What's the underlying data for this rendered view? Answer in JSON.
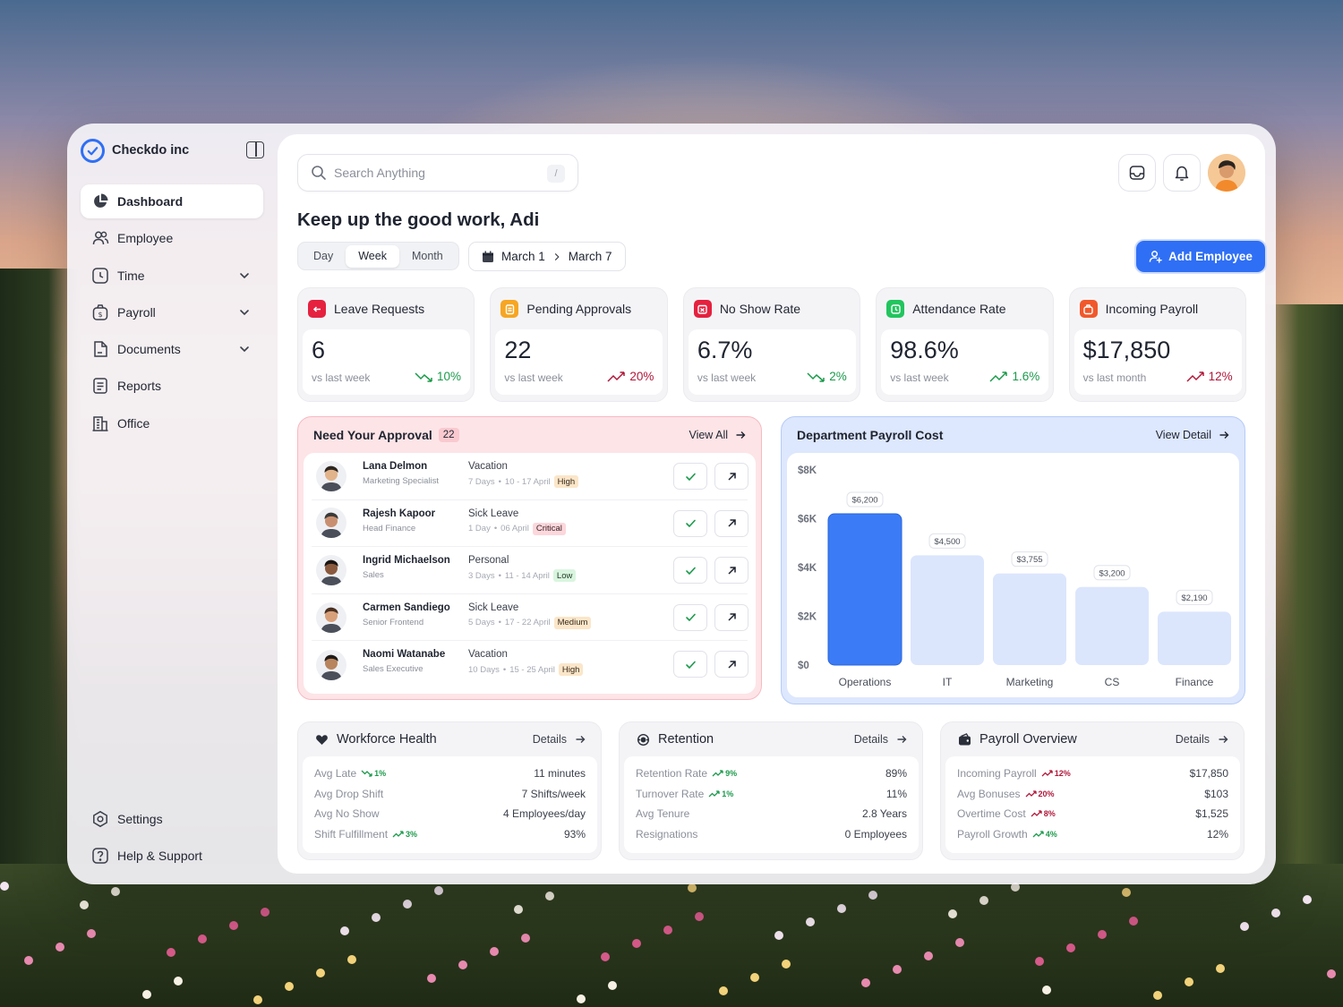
{
  "colors": {
    "accent": "#2f6ff5",
    "positive": "#1b9a4b",
    "negative": "#b0183a",
    "bar_primary": "#3b7cf6",
    "bar_muted": "#dbe6fd"
  },
  "brand": {
    "name": "Checkdo inc"
  },
  "sidebar": {
    "items": [
      {
        "label": "Dashboard",
        "icon": "pie-chart-icon",
        "active": true
      },
      {
        "label": "Employee",
        "icon": "users-icon"
      },
      {
        "label": "Time",
        "icon": "clock-icon",
        "expandable": true
      },
      {
        "label": "Payroll",
        "icon": "dollar-bag-icon",
        "expandable": true
      },
      {
        "label": "Documents",
        "icon": "document-icon",
        "expandable": true
      },
      {
        "label": "Reports",
        "icon": "report-icon"
      },
      {
        "label": "Office",
        "icon": "building-icon"
      }
    ],
    "bottom": [
      {
        "label": "Settings",
        "icon": "gear-icon"
      },
      {
        "label": "Help & Support",
        "icon": "help-icon"
      }
    ]
  },
  "search": {
    "placeholder": "Search Anything",
    "shortcut": "/"
  },
  "greeting": "Keep up the good work, Adi",
  "period": {
    "options": [
      "Day",
      "Week",
      "Month"
    ],
    "selected": "Week"
  },
  "date_range": {
    "start": "March 1",
    "end": "March 7"
  },
  "add_employee_label": "Add Employee",
  "kpis": [
    {
      "title": "Leave Requests",
      "value": "6",
      "sub": "vs last week",
      "trend": "10%",
      "direction": "down",
      "icon_color": "#e5213f"
    },
    {
      "title": "Pending Approvals",
      "value": "22",
      "sub": "vs last week",
      "trend": "20%",
      "direction": "up",
      "icon_color": "#f6a623"
    },
    {
      "title": "No Show Rate",
      "value": "6.7%",
      "sub": "vs last week",
      "trend": "2%",
      "direction": "down",
      "icon_color": "#e5213f"
    },
    {
      "title": "Attendance Rate",
      "value": "98.6%",
      "sub": "vs last week",
      "trend": "1.6%",
      "direction": "up",
      "icon_color": "#22c55e"
    },
    {
      "title": "Incoming Payroll",
      "value": "$17,850",
      "sub": "vs last month",
      "trend": "12%",
      "direction": "up",
      "icon_color": "#f0582c"
    }
  ],
  "approval": {
    "title": "Need Your Approval",
    "count": "22",
    "view_all": "View All",
    "rows": [
      {
        "name": "Lana Delmon",
        "role": "Marketing Specialist",
        "type": "Vacation",
        "days": "7 Days",
        "dates": "10 - 17 April",
        "priority": "High"
      },
      {
        "name": "Rajesh Kapoor",
        "role": "Head Finance",
        "type": "Sick Leave",
        "days": "1 Day",
        "dates": "06 April",
        "priority": "Critical"
      },
      {
        "name": "Ingrid Michaelson",
        "role": "Sales",
        "type": "Personal",
        "days": "3 Days",
        "dates": "11 - 14 April",
        "priority": "Low"
      },
      {
        "name": "Carmen Sandiego",
        "role": "Senior Frontend",
        "type": "Sick Leave",
        "days": "5 Days",
        "dates": "17 - 22 April",
        "priority": "Medium"
      },
      {
        "name": "Naomi Watanabe",
        "role": "Sales Executive",
        "type": "Vacation",
        "days": "10 Days",
        "dates": "15 - 25 April",
        "priority": "High"
      }
    ]
  },
  "dept_payroll": {
    "title": "Department Payroll Cost",
    "view_detail": "View Detail"
  },
  "chart_data": {
    "type": "bar",
    "title": "Department Payroll Cost",
    "categories": [
      "Operations",
      "IT",
      "Marketing",
      "CS",
      "Finance"
    ],
    "values": [
      6200,
      4500,
      3755,
      3200,
      2190
    ],
    "value_labels": [
      "$6,200",
      "$4,500",
      "$3,755",
      "$3,200",
      "$2,190"
    ],
    "highlighted": "Operations",
    "ylim": [
      0,
      8000
    ],
    "yticks": [
      0,
      2000,
      4000,
      6000,
      8000
    ],
    "ytick_labels": [
      "$0",
      "$2K",
      "$4K",
      "$6K",
      "$8K"
    ],
    "grid": false,
    "xlabel": "",
    "ylabel": ""
  },
  "bottom_cards": [
    {
      "title": "Workforce Health",
      "icon": "heart-icon",
      "link": "Details",
      "rows": [
        {
          "label": "Avg Late",
          "trend": "1%",
          "direction": "down",
          "value": "11 minutes"
        },
        {
          "label": "Avg Drop Shift",
          "trend": "",
          "direction": "",
          "value": "7 Shifts/week"
        },
        {
          "label": "Avg No Show",
          "trend": "",
          "direction": "",
          "value": "4 Employees/day"
        },
        {
          "label": "Shift Fulfillment",
          "trend": "3%",
          "direction": "up",
          "value": "93%"
        }
      ]
    },
    {
      "title": "Retention",
      "icon": "retention-icon",
      "link": "Details",
      "rows": [
        {
          "label": "Retention Rate",
          "trend": "9%",
          "direction": "up",
          "value": "89%"
        },
        {
          "label": "Turnover Rate",
          "trend": "1%",
          "direction": "up",
          "value": "11%"
        },
        {
          "label": "Avg Tenure",
          "trend": "",
          "direction": "",
          "value": "2.8 Years"
        },
        {
          "label": "Resignations",
          "trend": "",
          "direction": "",
          "value": "0 Employees"
        }
      ]
    },
    {
      "title": "Payroll Overview",
      "icon": "wallet-icon",
      "link": "Details",
      "rows": [
        {
          "label": "Incoming Payroll",
          "trend": "12%",
          "direction": "up-red",
          "value": "$17,850"
        },
        {
          "label": "Avg Bonuses",
          "trend": "20%",
          "direction": "up-red",
          "value": "$103"
        },
        {
          "label": "Overtime Cost",
          "trend": "8%",
          "direction": "up-red",
          "value": "$1,525"
        },
        {
          "label": "Payroll Growth",
          "trend": "4%",
          "direction": "up",
          "value": "12%"
        }
      ]
    }
  ]
}
